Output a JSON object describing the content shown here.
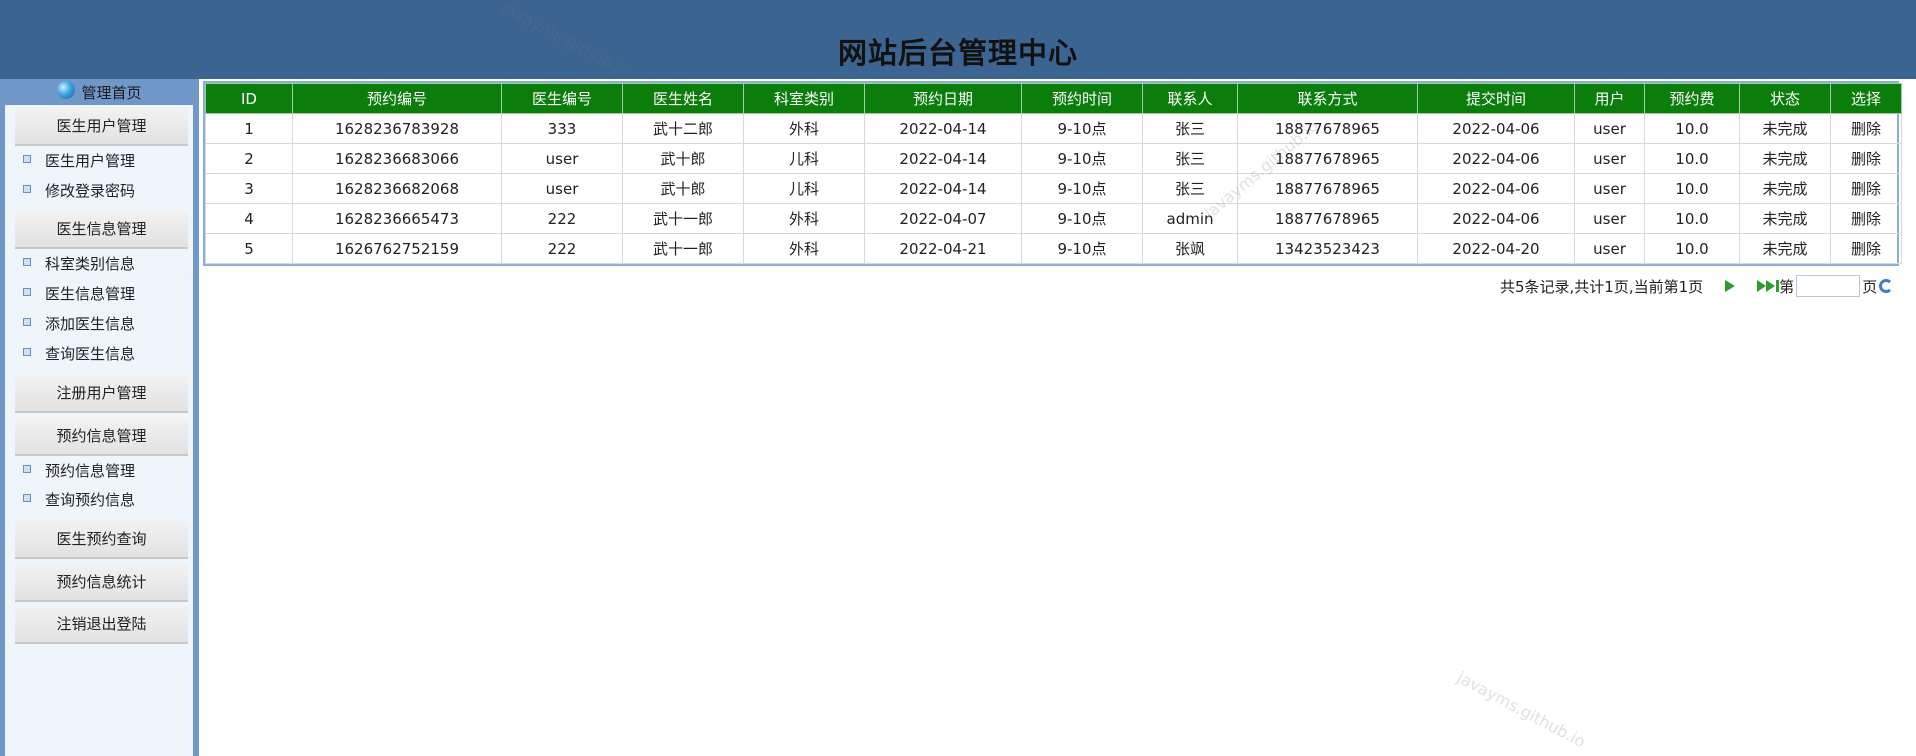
{
  "header": {
    "title": "网站后台管理中心"
  },
  "sidebar": {
    "home": "管理首页",
    "groups": [
      {
        "label": "医生用户管理",
        "items": [
          "医生用户管理",
          "修改登录密码"
        ]
      },
      {
        "label": "医生信息管理",
        "items": [
          "科室类别信息",
          "医生信息管理",
          "添加医生信息",
          "查询医生信息"
        ]
      },
      {
        "label": "注册用户管理",
        "items": []
      },
      {
        "label": "预约信息管理",
        "items": [
          "预约信息管理",
          "查询预约信息"
        ]
      },
      {
        "label": "医生预约查询",
        "items": []
      },
      {
        "label": "预约信息统计",
        "items": []
      },
      {
        "label": "注销退出登陆",
        "items": []
      }
    ]
  },
  "table": {
    "headers": [
      "ID",
      "预约编号",
      "医生编号",
      "医生姓名",
      "科室类别",
      "预约日期",
      "预约时间",
      "联系人",
      "联系方式",
      "提交时间",
      "用户",
      "预约费",
      "状态",
      "选择"
    ],
    "rows": [
      [
        "1",
        "1628236783928",
        "333",
        "武十二郎",
        "外科",
        "2022-04-14",
        "9-10点",
        "张三",
        "18877678965",
        "2022-04-06",
        "user",
        "10.0",
        "未完成",
        "删除"
      ],
      [
        "2",
        "1628236683066",
        "user",
        "武十郎",
        "儿科",
        "2022-04-14",
        "9-10点",
        "张三",
        "18877678965",
        "2022-04-06",
        "user",
        "10.0",
        "未完成",
        "删除"
      ],
      [
        "3",
        "1628236682068",
        "user",
        "武十郎",
        "儿科",
        "2022-04-14",
        "9-10点",
        "张三",
        "18877678965",
        "2022-04-06",
        "user",
        "10.0",
        "未完成",
        "删除"
      ],
      [
        "4",
        "1628236665473",
        "222",
        "武十一郎",
        "外科",
        "2022-04-07",
        "9-10点",
        "admin",
        "18877678965",
        "2022-04-06",
        "user",
        "10.0",
        "未完成",
        "删除"
      ],
      [
        "5",
        "1626762752159",
        "222",
        "武十一郎",
        "外科",
        "2022-04-21",
        "9-10点",
        "张飒",
        "13423523423",
        "2022-04-20",
        "user",
        "10.0",
        "未完成",
        "删除"
      ]
    ]
  },
  "pager": {
    "summary": "共5条记录,共计1页,当前第1页",
    "page_prefix": "第",
    "page_suffix": "页",
    "page_value": ""
  },
  "watermark": "javayms.github.io",
  "colors": {
    "header": "#3b6590",
    "table_header": "#0a7d0a",
    "sidebar": "#6f98c8"
  },
  "icons": {
    "home": "globe-icon",
    "bullet": "bullet-icon",
    "next": "play-icon",
    "last": "last-page-icon",
    "go": "refresh-icon"
  }
}
